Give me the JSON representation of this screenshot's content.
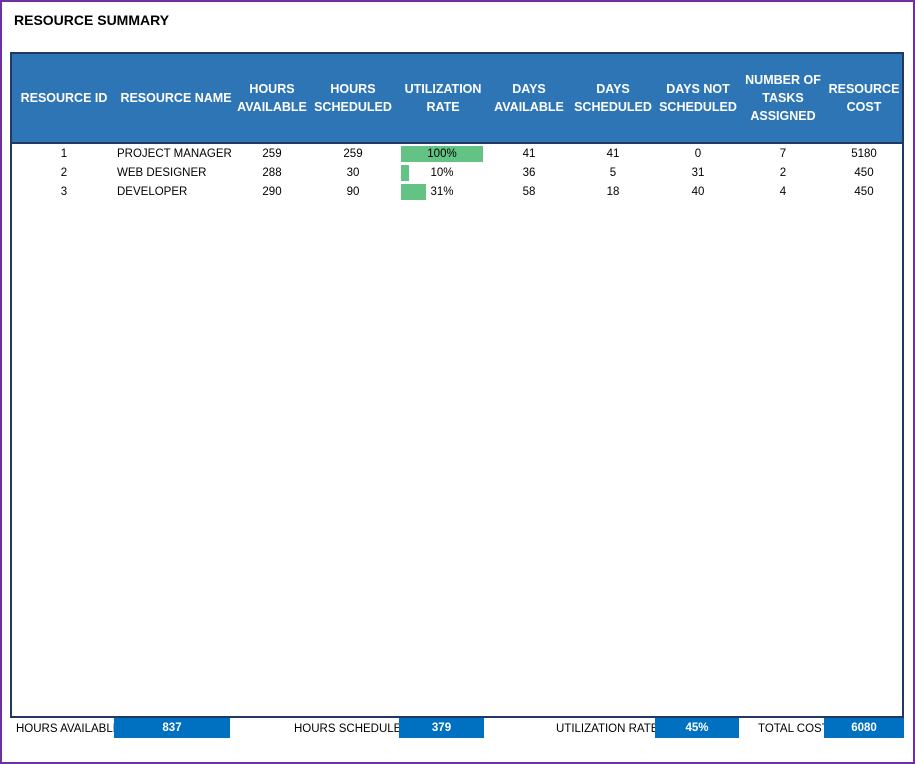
{
  "title": "RESOURCE SUMMARY",
  "columns": [
    [
      "RESOURCE ID"
    ],
    [
      "RESOURCE NAME"
    ],
    [
      "HOURS",
      "AVAILABLE"
    ],
    [
      "HOURS",
      "SCHEDULED"
    ],
    [
      "UTILIZATION",
      "RATE"
    ],
    [
      "DAYS",
      "AVAILABLE"
    ],
    [
      "DAYS",
      "SCHEDULED"
    ],
    [
      "DAYS NOT",
      "SCHEDULED"
    ],
    [
      "NUMBER OF",
      "TASKS",
      "ASSIGNED"
    ],
    [
      "RESOURCE",
      "COST"
    ]
  ],
  "rows": [
    {
      "id": "1",
      "name": "PROJECT MANAGER",
      "hours_available": "259",
      "hours_scheduled": "259",
      "utilization": "100%",
      "utilization_fraction": 1.0,
      "days_available": "41",
      "days_scheduled": "41",
      "days_not_scheduled": "0",
      "tasks": "7",
      "cost": "5180"
    },
    {
      "id": "2",
      "name": "WEB DESIGNER",
      "hours_available": "288",
      "hours_scheduled": "30",
      "utilization": "10%",
      "utilization_fraction": 0.1,
      "days_available": "36",
      "days_scheduled": "5",
      "days_not_scheduled": "31",
      "tasks": "2",
      "cost": "450"
    },
    {
      "id": "3",
      "name": "DEVELOPER",
      "hours_available": "290",
      "hours_scheduled": "90",
      "utilization": "31%",
      "utilization_fraction": 0.31,
      "days_available": "58",
      "days_scheduled": "18",
      "days_not_scheduled": "40",
      "tasks": "4",
      "cost": "450"
    }
  ],
  "footer": {
    "hours_available_label": "HOURS AVAILABLE",
    "hours_available_value": "837",
    "hours_scheduled_label": "HOURS SCHEDULED",
    "hours_scheduled_value": "379",
    "utilization_label": "UTILIZATION RATE",
    "utilization_value": "45%",
    "total_cost_label": "TOTAL COST",
    "total_cost_value": "6080"
  },
  "colors": {
    "header_bg": "#2e75b6",
    "utilization_bar": "#63c384",
    "footer_box": "#0070c0",
    "frame_border": "#7030a0"
  }
}
